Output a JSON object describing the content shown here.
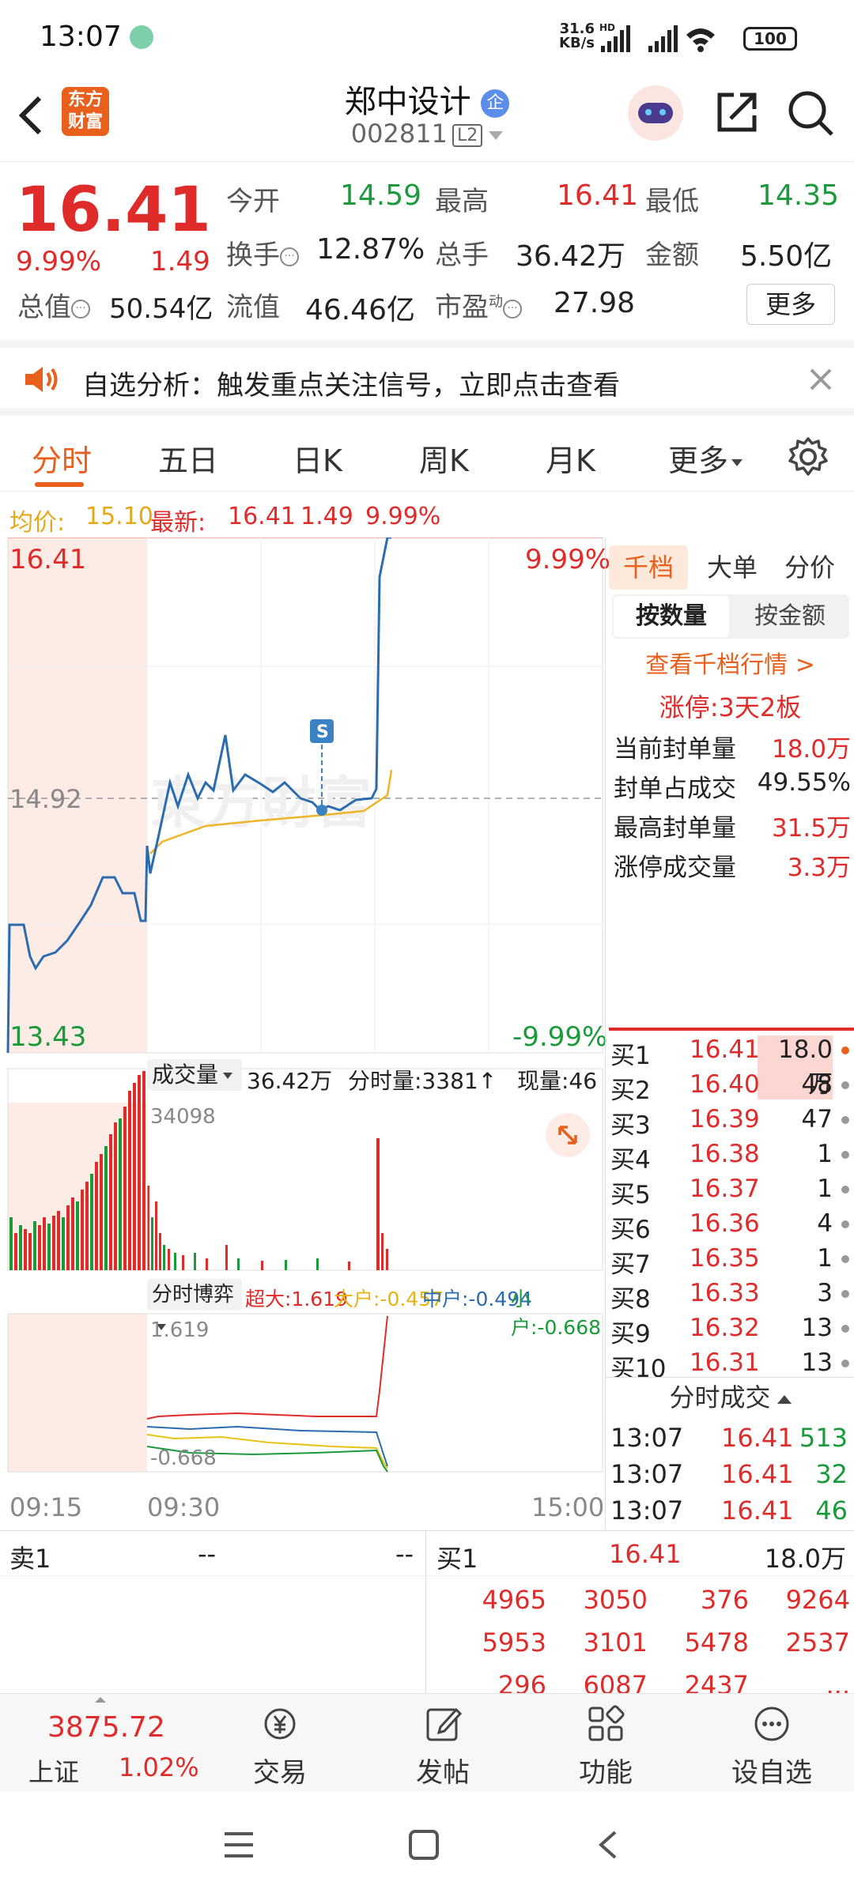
{
  "status_bar": {
    "time": "13:07",
    "net_speed_top": "31.6",
    "net_speed_bottom": "KB/s",
    "battery": "100",
    "signal_labels": [
      "HD",
      "HD"
    ]
  },
  "header": {
    "logo_top": "东方",
    "logo_bottom": "财富",
    "title": "郑中设计",
    "title_badge": "企",
    "code": "002811",
    "level_badge": "L2"
  },
  "quote": {
    "price": "16.41",
    "change_pct": "9.99%",
    "change": "1.49",
    "fields": {
      "open_label": "今开",
      "open": "14.59",
      "high_label": "最高",
      "high": "16.41",
      "low_label": "最低",
      "low": "14.35",
      "turnover_label": "换手",
      "turnover": "12.87%",
      "volume_label": "总手",
      "volume": "36.42万",
      "amount_label": "金额",
      "amount": "5.50亿",
      "mktcap_label": "总值",
      "mktcap": "50.54亿",
      "float_label": "流值",
      "float": "46.46亿",
      "pe_label": "市盈",
      "pe_sup": "动",
      "pe": "27.98"
    },
    "more_button": "更多"
  },
  "alert": {
    "text": "自选分析：触发重点关注信号，立即点击查看"
  },
  "tabs": {
    "items": [
      "分时",
      "五日",
      "日K",
      "周K",
      "月K",
      "更多"
    ],
    "active": "分时"
  },
  "avg_line": {
    "avg_label": "均价:",
    "avg": "15.10",
    "last_label": "最新:",
    "last": "16.41",
    "chg": "1.49",
    "pct": "9.99%"
  },
  "chart": {
    "y_top": "16.41",
    "y_mid": "14.92",
    "y_bot": "13.43",
    "pct_top": "9.99%",
    "pct_bot": "-9.99%",
    "volume_label": "成交量",
    "volume_total": "36.42万",
    "tick_label": "分时量:3381↑",
    "now_label": "现量:46",
    "volume_max": "34098",
    "flow_label": "分时博弈",
    "flow_super": "超大:1.619",
    "flow_big": "大户:-0.457",
    "flow_mid": "中户:-0.494",
    "flow_small": "小户:-0.668",
    "flow_max": "1.619",
    "flow_min": "-0.668",
    "time_start": "09:15",
    "time_open": "09:30",
    "time_end": "15:00",
    "marker": "S"
  },
  "side": {
    "tabs": [
      "千档",
      "大单",
      "分价"
    ],
    "subtabs": [
      "按数量",
      "按金额"
    ],
    "link": "查看千档行情 >",
    "limit_label": "涨停:",
    "limit_value": "3天2板",
    "stats": [
      {
        "label": "当前封单量",
        "value": "18.0万"
      },
      {
        "label": "封单占成交",
        "value": "49.55%"
      },
      {
        "label": "最高封单量",
        "value": "31.5万"
      },
      {
        "label": "涨停成交量",
        "value": "3.3万"
      }
    ],
    "bids": [
      {
        "label": "买1",
        "price": "16.41",
        "vol": "18.0万"
      },
      {
        "label": "买2",
        "price": "16.40",
        "vol": "48"
      },
      {
        "label": "买3",
        "price": "16.39",
        "vol": "47"
      },
      {
        "label": "买4",
        "price": "16.38",
        "vol": "1"
      },
      {
        "label": "买5",
        "price": "16.37",
        "vol": "1"
      },
      {
        "label": "买6",
        "price": "16.36",
        "vol": "4"
      },
      {
        "label": "买7",
        "price": "16.35",
        "vol": "1"
      },
      {
        "label": "买8",
        "price": "16.33",
        "vol": "3"
      },
      {
        "label": "买9",
        "price": "16.32",
        "vol": "13"
      },
      {
        "label": "买10",
        "price": "16.31",
        "vol": "13"
      }
    ],
    "trades_title": "分时成交",
    "trades": [
      {
        "time": "13:07",
        "price": "16.41",
        "vol": "513"
      },
      {
        "time": "13:07",
        "price": "16.41",
        "vol": "32"
      },
      {
        "time": "13:07",
        "price": "16.41",
        "vol": "46"
      }
    ]
  },
  "queue": {
    "sell_label": "卖1",
    "sell_price": "--",
    "sell_vol": "--",
    "buy_label": "买1",
    "buy_price": "16.41",
    "buy_vol": "18.0万",
    "rows": [
      [
        "4965",
        "3050",
        "376",
        "9264"
      ],
      [
        "5953",
        "3101",
        "5478",
        "2537"
      ],
      [
        "296",
        "6087",
        "2437",
        "..."
      ]
    ]
  },
  "index": {
    "value": "3875.72",
    "name": "上证",
    "pct": "1.02%"
  },
  "tabbar": [
    "交易",
    "发帖",
    "功能",
    "设自选"
  ],
  "colors": {
    "up": "#e02b2b",
    "down": "#1a9a3a",
    "price_line": "#2b6cb0",
    "avg_line": "#f0b429",
    "accent": "#e8601c"
  }
}
